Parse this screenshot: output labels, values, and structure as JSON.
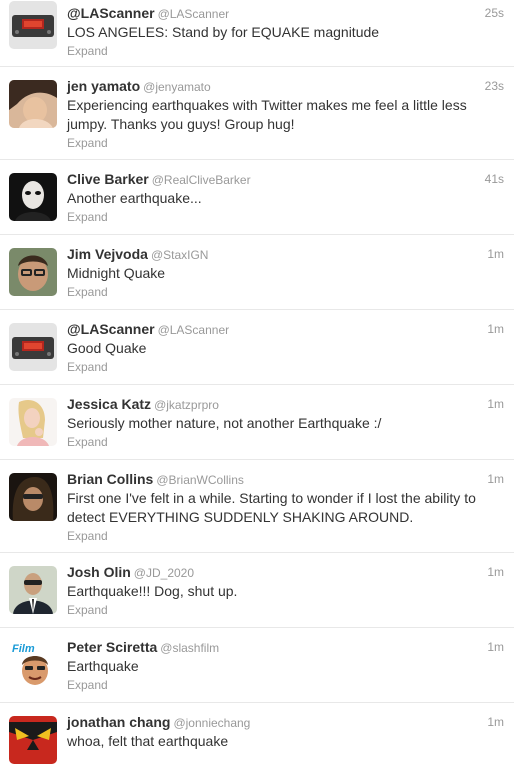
{
  "expand_label": "Expand",
  "tweets": [
    {
      "name": "@LAScanner",
      "handle": "@LAScanner",
      "time": "25s",
      "text": "LOS ANGELES: Stand by for EQUAKE magnitude",
      "avatar": "scanner-avatar"
    },
    {
      "name": "jen yamato",
      "handle": "@jenyamato",
      "time": "23s",
      "text": "Experiencing earthquakes with Twitter makes me feel a little less jumpy. Thanks you guys! Group hug!",
      "avatar": "jen-yamato-avatar"
    },
    {
      "name": "Clive Barker",
      "handle": "@RealCliveBarker",
      "time": "41s",
      "text": "Another earthquake...",
      "avatar": "clive-barker-avatar"
    },
    {
      "name": "Jim Vejvoda",
      "handle": "@StaxIGN",
      "time": "1m",
      "text": "Midnight Quake",
      "avatar": "jim-vejvoda-avatar"
    },
    {
      "name": "@LAScanner",
      "handle": "@LAScanner",
      "time": "1m",
      "text": "Good Quake",
      "avatar": "scanner-avatar"
    },
    {
      "name": "Jessica Katz",
      "handle": "@jkatzprpro",
      "time": "1m",
      "text": "Seriously mother nature, not another Earthquake :/",
      "avatar": "jessica-katz-avatar"
    },
    {
      "name": "Brian Collins",
      "handle": "@BrianWCollins",
      "time": "1m",
      "text": "First one I've felt in a while. Starting to wonder if I lost the ability to detect EVERYTHING SUDDENLY SHAKING AROUND.",
      "avatar": "brian-collins-avatar"
    },
    {
      "name": "Josh Olin",
      "handle": "@JD_2020",
      "time": "1m",
      "text": "Earthquake!!! Dog, shut up.",
      "avatar": "josh-olin-avatar"
    },
    {
      "name": "Peter Sciretta",
      "handle": "@slashfilm",
      "time": "1m",
      "text": "Earthquake",
      "avatar": "slashfilm-avatar",
      "avatar_text": "Film"
    },
    {
      "name": "jonathan chang",
      "handle": "@jonniechang",
      "time": "1m",
      "text": "whoa, felt that earthquake",
      "avatar": "jonathan-chang-avatar"
    }
  ]
}
